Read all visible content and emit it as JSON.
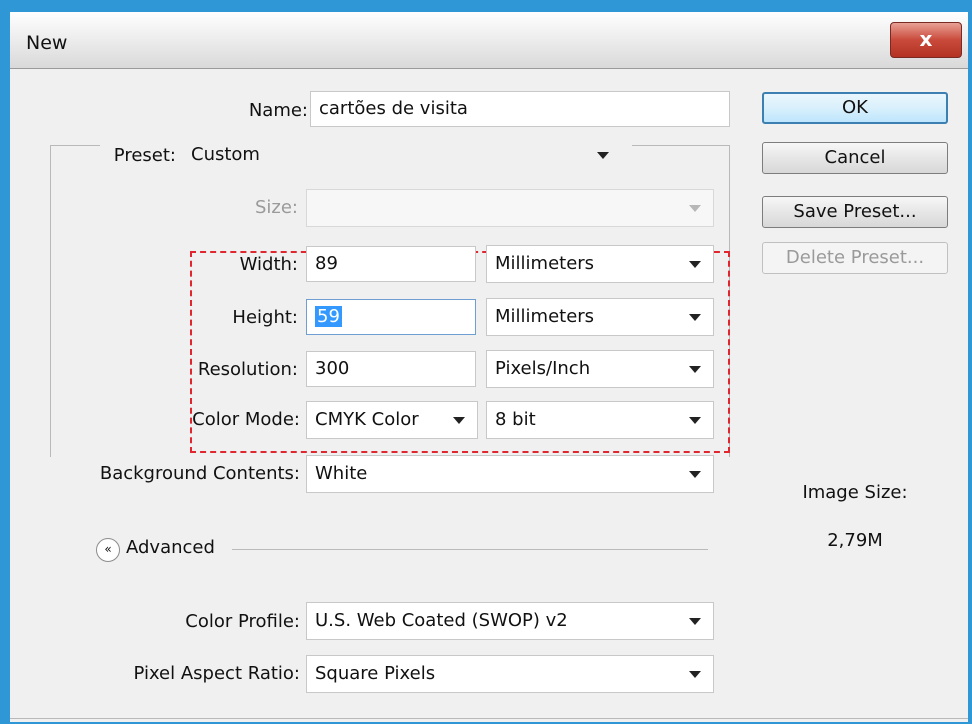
{
  "window": {
    "title": "New",
    "close_glyph": "x"
  },
  "form": {
    "name": {
      "label": "Name:",
      "value": "cartões de visita"
    },
    "preset": {
      "label": "Preset:",
      "value": "Custom"
    },
    "size": {
      "label": "Size:",
      "value": ""
    },
    "width": {
      "label": "Width:",
      "value": "89",
      "unit": "Millimeters"
    },
    "height": {
      "label": "Height:",
      "value": "59",
      "unit": "Millimeters"
    },
    "resolution": {
      "label": "Resolution:",
      "value": "300",
      "unit": "Pixels/Inch"
    },
    "color_mode": {
      "label": "Color Mode:",
      "value": "CMYK Color",
      "depth": "8 bit"
    },
    "background": {
      "label": "Background Contents:",
      "value": "White"
    },
    "advanced": {
      "label": "Advanced",
      "icon": "chevron-up-double-icon",
      "glyph": "«"
    },
    "color_profile": {
      "label": "Color Profile:",
      "value": "U.S. Web Coated (SWOP) v2"
    },
    "pixel_aspect": {
      "label": "Pixel Aspect Ratio:",
      "value": "Square Pixels"
    }
  },
  "buttons": {
    "ok": "OK",
    "cancel": "Cancel",
    "save_preset": "Save Preset...",
    "delete_preset": "Delete Preset..."
  },
  "image_size": {
    "label": "Image Size:",
    "value": "2,79M"
  },
  "colors": {
    "highlight_box": "#e0262e",
    "selection": "#3399ff",
    "window_frame": "#2f97d6"
  }
}
